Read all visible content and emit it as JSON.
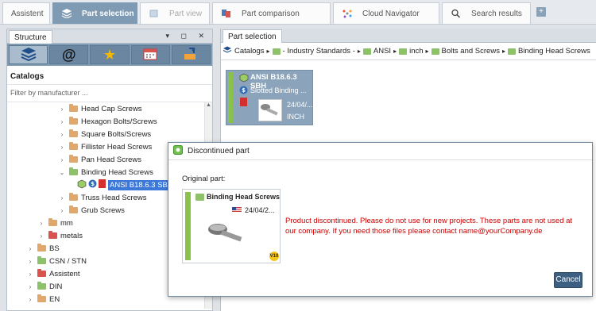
{
  "top_tabs": [
    {
      "label": "Assistent",
      "icon": "none"
    },
    {
      "label": "Part selection",
      "icon": "layers-icon"
    },
    {
      "label": "Part view",
      "icon": "cube-icon"
    },
    {
      "label": "Part comparison",
      "icon": "compare-icon"
    },
    {
      "label": "Cloud Navigator",
      "icon": "cloud-navigator-icon"
    },
    {
      "label": "Search results",
      "icon": "search-icon"
    }
  ],
  "add_tab_label": "+",
  "structure_panel": {
    "tab_label": "Structure",
    "controls": "▾ ◻ ✕",
    "catalogs_title": "Catalogs",
    "filter_placeholder": "Filter by manufacturer ..."
  },
  "tree": [
    {
      "label": "Head Cap Screws",
      "color": "#e0a86a",
      "arrow": "›"
    },
    {
      "label": "Hexagon Bolts/Screws",
      "color": "#e0a86a",
      "arrow": "›"
    },
    {
      "label": "Square Bolts/Screws",
      "color": "#e0a86a",
      "arrow": "›"
    },
    {
      "label": "Fillister Head Screws",
      "color": "#e0a86a",
      "arrow": "›"
    },
    {
      "label": "Pan Head Screws",
      "color": "#e0a86a",
      "arrow": "›"
    },
    {
      "label": "Binding Head Screws",
      "color": "#8dc26a",
      "arrow": "⌄"
    },
    {
      "label": "ANSI B18.6.3 SBH",
      "color": "",
      "arrow": ""
    },
    {
      "label": "Truss Head Screws",
      "color": "#e0a86a",
      "arrow": "›"
    },
    {
      "label": "Grub Screws",
      "color": "#e0a86a",
      "arrow": "›"
    },
    {
      "label": "mm",
      "color": "#e0a86a",
      "arrow": "›"
    },
    {
      "label": "metals",
      "color": "#d9534f",
      "arrow": "›"
    },
    {
      "label": "BS",
      "color": "#e0a86a",
      "arrow": "›"
    },
    {
      "label": "CSN / STN",
      "color": "#8dc26a",
      "arrow": "›"
    },
    {
      "label": "Assistent",
      "color": "#d9534f",
      "arrow": "›"
    },
    {
      "label": "DIN",
      "color": "#8dc26a",
      "arrow": "›"
    },
    {
      "label": "EN",
      "color": "#e0a86a",
      "arrow": "›"
    }
  ],
  "part_selection_panel": {
    "tab_label": "Part selection",
    "breadcrumb": [
      "Catalogs",
      "- Industry Standards -",
      "ANSI",
      "inch",
      "Bolts and Screws",
      "Binding Head Screws"
    ]
  },
  "part_card": {
    "title": "ANSI B18.6.3 SBH",
    "subtitle": "Slotted Binding ...",
    "date": "24/04/...",
    "unit": "INCH"
  },
  "dialog": {
    "title": "Discontinued part",
    "original_label": "Original part:",
    "card_title": "Binding Head Screws",
    "card_date": "24/04/2...",
    "card_badge": "V10",
    "message": "Product discontinued. Please do not use for new projects. These parts are not used at our company. If you need those files please contact name@yourCompany.de",
    "cancel_label": "Cancel"
  },
  "colors": {
    "accent": "#7f9ab3",
    "status_green": "#8bc34a",
    "error_red": "#cc0000",
    "button_blue": "#3c5f82"
  }
}
